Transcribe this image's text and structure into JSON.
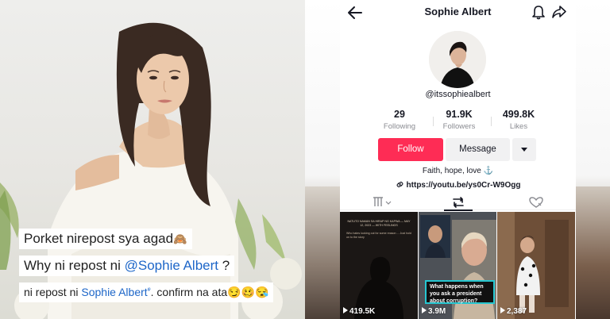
{
  "left_panel": {
    "caption_1": "Porket nirepost sya agad",
    "caption_1_emoji": "🙈",
    "caption_2_prefix": "Why ni repost ni ",
    "caption_2_mention": "@Sophie Albert",
    "caption_2_suffix": " ?",
    "caption_3_prefix": "ni repost ni ",
    "caption_3_mention": "Sophie Albert",
    "caption_3_search_glyph": "ᵠ",
    "caption_3_suffix": ". confirm na ata",
    "caption_3_emojis": "😏🥴😪"
  },
  "profile": {
    "title": "Sophie Albert",
    "handle": "@itssophiealbert",
    "stats": [
      {
        "value": "29",
        "label": "Following"
      },
      {
        "value": "91.9K",
        "label": "Followers"
      },
      {
        "value": "499.8K",
        "label": "Likes"
      }
    ],
    "follow_label": "Follow",
    "message_label": "Message",
    "bio": "Faith, hope, love ⚓",
    "link": "https://youtu.be/ys0Cr-W9Ogg"
  },
  "videos": [
    {
      "views": "419.5K",
      "header": "NATUTO NAMAN SA HIRAP NG KAPWA — MAY 12, 2023 — WITH FEELINGS",
      "body": "Who hates looking out for some reason ... Just hold on to the story"
    },
    {
      "views": "3.9M",
      "banner": "What happens when you ask a president about corruption?"
    },
    {
      "views": "2,387"
    }
  ],
  "icons": {
    "back": "arrow-left-icon",
    "bell": "bell-icon",
    "share": "share-icon",
    "link": "link-icon",
    "grid_tab": "grid-icon",
    "repost_tab": "repost-icon",
    "liked_tab": "liked-icon"
  },
  "colors": {
    "follow_bg": "#fe2c55",
    "mention": "#1d66c8",
    "banner_border": "#26c6d0"
  }
}
